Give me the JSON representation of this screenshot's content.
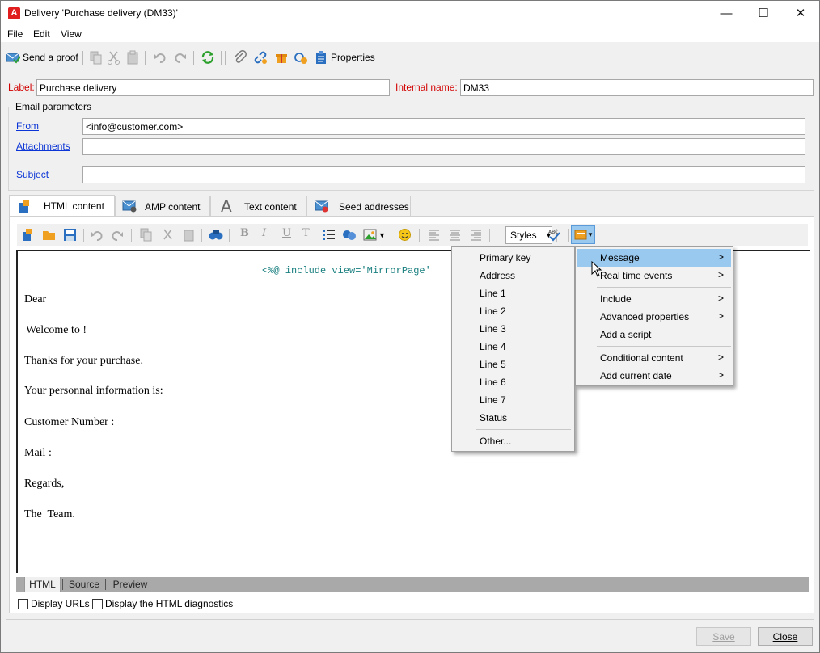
{
  "window": {
    "title": "Delivery 'Purchase delivery (DM33)'",
    "controls": {
      "minimize": "—",
      "maximize": "☐",
      "close": "✕"
    }
  },
  "menubar": [
    "File",
    "Edit",
    "View"
  ],
  "toolbar": {
    "send_proof": "Send a proof",
    "properties": "Properties"
  },
  "header": {
    "label_caption": "Label:",
    "label_value": "Purchase delivery",
    "internal_name_caption": "Internal name:",
    "internal_name_value": "DM33"
  },
  "email_params": {
    "legend": "Email parameters",
    "from_link": "From",
    "from_value": "<info@customer.com>",
    "attachments_link": "Attachments",
    "attachments_value": "",
    "subject_link": "Subject",
    "subject_value": ""
  },
  "tabs": [
    {
      "label": "HTML content",
      "active": true
    },
    {
      "label": "AMP content",
      "active": false
    },
    {
      "label": "Text content",
      "active": false
    },
    {
      "label": "Seed addresses",
      "active": false
    }
  ],
  "editor_toolbar": {
    "styles_value": "Styles",
    "bold": "B",
    "italic": "I",
    "underline": "U",
    "clear": "T"
  },
  "editor": {
    "include_code": "<%@ include view='MirrorPage'",
    "lines": [
      "Dear",
      "Welcome to !",
      "Thanks for your purchase.",
      "Your personnal information is:",
      "Customer Number :",
      "Mail :",
      "Regards,",
      "The  Team."
    ]
  },
  "view_tabs": [
    {
      "label": "HTML",
      "active": true
    },
    {
      "label": "Source",
      "active": false
    },
    {
      "label": "Preview",
      "active": false
    }
  ],
  "options": {
    "display_urls": "Display URLs",
    "display_diagnostics": "Display the HTML diagnostics"
  },
  "buttons": {
    "save": "Save",
    "close": "Close"
  },
  "context_menu": {
    "items": [
      {
        "label": "Message",
        "submenu": true,
        "highlighted": true
      },
      {
        "label": "Real time events",
        "submenu": true
      },
      {
        "label": "Include",
        "submenu": true
      },
      {
        "label": "Advanced properties",
        "submenu": true
      },
      {
        "label": "Add a script",
        "submenu": false
      },
      {
        "label": "Conditional content",
        "submenu": true
      },
      {
        "label": "Add current date",
        "submenu": true
      }
    ],
    "arrow": ">"
  },
  "submenu": {
    "items": [
      "Primary key",
      "Address",
      "Line 1",
      "Line 2",
      "Line 3",
      "Line 4",
      "Line 5",
      "Line 6",
      "Line 7",
      "Status"
    ],
    "other": "Other..."
  },
  "colors": {
    "accent": "#99c9ef",
    "label_red": "#d20000",
    "link_blue": "#0b35d6"
  }
}
